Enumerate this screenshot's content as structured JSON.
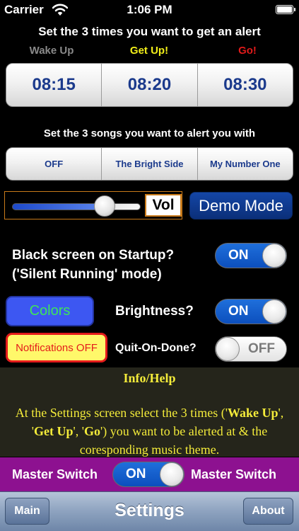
{
  "status_bar": {
    "carrier": "Carrier",
    "time": "1:06 PM",
    "icons": [
      "wifi-icon",
      "battery-icon"
    ]
  },
  "alerts": {
    "heading": "Set the 3 times you want to get an alert",
    "stages": [
      {
        "label": "Wake Up",
        "color": "#8a8a8a"
      },
      {
        "label": "Get Up!",
        "color": "#f2ef19"
      },
      {
        "label": "Go!",
        "color": "#e01a1a"
      }
    ],
    "times": [
      "08:15",
      "08:20",
      "08:30"
    ]
  },
  "songs": {
    "heading": "Set the 3 songs you want to alert you with",
    "items": [
      "OFF",
      "The Bright Side",
      "My Number One"
    ]
  },
  "volume": {
    "label": "Vol",
    "level_percent": 72
  },
  "demo_button": "Demo Mode",
  "black_screen": {
    "line1": "Black screen on Startup?",
    "line2": "('Silent Running' mode)",
    "state": "ON"
  },
  "colors_button": {
    "label": "Colors",
    "bg": "#3d57f2",
    "text_color": "#3ee45a"
  },
  "brightness": {
    "label": "Brightness?",
    "state": "ON"
  },
  "notifications_button": {
    "label": "Notifications OFF",
    "bg": "#fff86a",
    "border": "#e41b1b"
  },
  "quit_on_done": {
    "label": "Quit-On-Done?",
    "state": "OFF"
  },
  "info": {
    "title": "Info/Help",
    "text_parts": [
      "At the Settings screen select the 3 times (",
      "Wake Up",
      "', '",
      "Get Up",
      "', '",
      "Go",
      "') you want to be alerted at & the coresponding music theme."
    ]
  },
  "master": {
    "left_label": "Master Switch",
    "right_label": "Master Switch",
    "state": "ON",
    "bg": "#8d1190"
  },
  "navbar": {
    "left_button": "Main",
    "title": "Settings",
    "right_button": "About"
  }
}
